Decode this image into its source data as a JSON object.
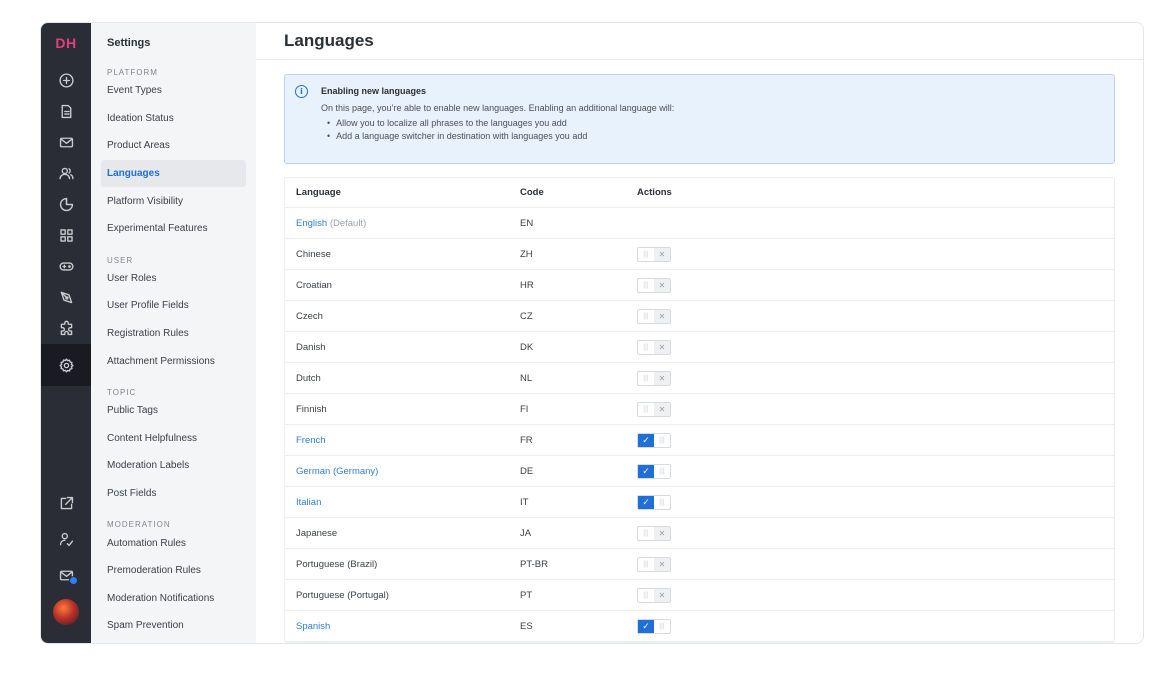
{
  "brand": {
    "logo": "DH"
  },
  "rail": {
    "icons": [
      "plus-circle-icon",
      "document-icon",
      "mail-icon",
      "users-icon",
      "pie-chart-icon",
      "grid-icon",
      "gamepad-icon",
      "pen-icon",
      "puzzle-icon",
      "gear-icon"
    ],
    "bottom_icons": [
      "external-link-icon",
      "user-route-icon",
      "mail-badge-icon"
    ]
  },
  "nav": {
    "title": "Settings",
    "sections": [
      {
        "label": "PLATFORM",
        "items": [
          "Event Types",
          "Ideation Status",
          "Product Areas",
          "Languages",
          "Platform Visibility",
          "Experimental Features"
        ]
      },
      {
        "label": "USER",
        "items": [
          "User Roles",
          "User Profile Fields",
          "Registration Rules",
          "Attachment Permissions"
        ]
      },
      {
        "label": "TOPIC",
        "items": [
          "Public Tags",
          "Content Helpfulness",
          "Moderation Labels",
          "Post Fields"
        ]
      },
      {
        "label": "MODERATION",
        "items": [
          "Automation Rules",
          "Premoderation Rules",
          "Moderation Notifications",
          "Spam Prevention"
        ]
      }
    ],
    "active": "Languages"
  },
  "header": {
    "title": "Languages"
  },
  "info": {
    "title": "Enabling new languages",
    "text": "On this page, you’re able to enable new languages. Enabling an additional language will:",
    "bullets": [
      "Allow you to localize all phrases to the languages you add",
      "Add a language switcher in destination with languages you add"
    ]
  },
  "table": {
    "headers": {
      "language": "Language",
      "code": "Code",
      "actions": "Actions"
    },
    "default_suffix": "(Default)",
    "rows": [
      {
        "name": "English",
        "code": "EN",
        "state": "default"
      },
      {
        "name": "Chinese",
        "code": "ZH",
        "state": "off"
      },
      {
        "name": "Croatian",
        "code": "HR",
        "state": "off"
      },
      {
        "name": "Czech",
        "code": "CZ",
        "state": "off"
      },
      {
        "name": "Danish",
        "code": "DK",
        "state": "off"
      },
      {
        "name": "Dutch",
        "code": "NL",
        "state": "off"
      },
      {
        "name": "Finnish",
        "code": "FI",
        "state": "off"
      },
      {
        "name": "French",
        "code": "FR",
        "state": "on"
      },
      {
        "name": "German (Germany)",
        "code": "DE",
        "state": "on"
      },
      {
        "name": "Italian",
        "code": "IT",
        "state": "on"
      },
      {
        "name": "Japanese",
        "code": "JA",
        "state": "off"
      },
      {
        "name": "Portuguese (Brazil)",
        "code": "PT-BR",
        "state": "off"
      },
      {
        "name": "Portuguese (Portugal)",
        "code": "PT",
        "state": "off"
      },
      {
        "name": "Spanish",
        "code": "ES",
        "state": "on"
      }
    ]
  },
  "colors": {
    "rail_bg": "#2b2d36",
    "accent": "#1f6fd6",
    "logo": "#e2407b",
    "info_bg": "#e8f2fd"
  }
}
